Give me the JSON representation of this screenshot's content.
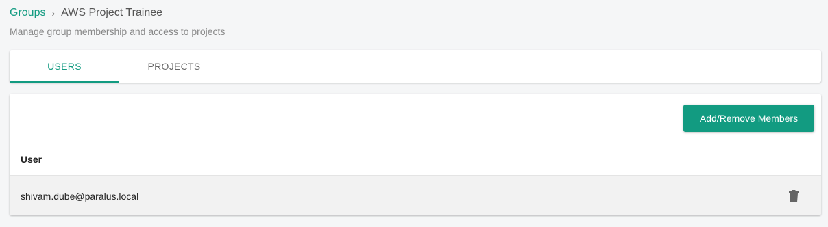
{
  "breadcrumb": {
    "parent": "Groups",
    "separator": "›",
    "current": "AWS Project Trainee"
  },
  "subtitle": "Manage group membership and access to projects",
  "tabs": [
    {
      "label": "USERS",
      "active": true
    },
    {
      "label": "PROJECTS",
      "active": false
    }
  ],
  "actions": {
    "add_remove_label": "Add/Remove Members"
  },
  "table": {
    "columns": [
      "User"
    ],
    "rows": [
      {
        "user": "shivam.dube@paralus.local"
      }
    ]
  },
  "colors": {
    "accent": "#129b81",
    "background": "#f5f6f7",
    "row_background": "#f2f2f2",
    "icon": "#666666"
  },
  "icons": {
    "row_action": "trash-icon"
  }
}
